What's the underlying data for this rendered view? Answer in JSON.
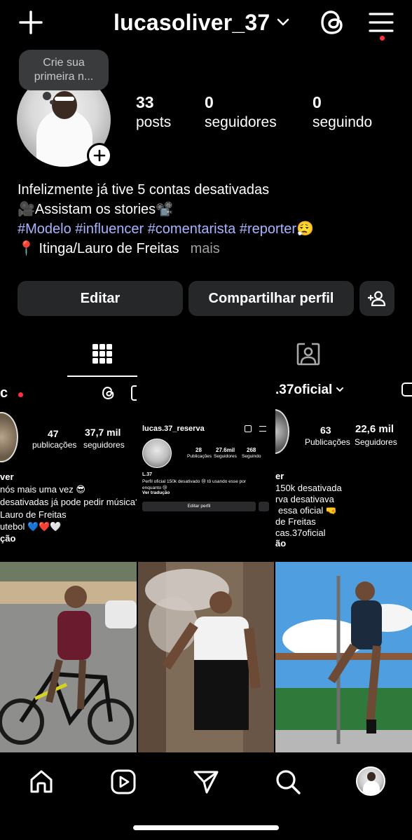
{
  "header": {
    "username": "lucasoliver_37",
    "icons": [
      "plus-icon",
      "chevron-down-icon",
      "threads-icon",
      "hamburger-menu-icon"
    ]
  },
  "profile": {
    "note_placeholder_line1": "Crie sua",
    "note_placeholder_line2": "primeira n...",
    "stats": {
      "posts_count": "33",
      "posts_label": "posts",
      "followers_count": "0",
      "followers_label": "seguidores",
      "following_count": "0",
      "following_label": "seguindo"
    }
  },
  "bio": {
    "line1": "Infelizmente já tive 5 contas desativadas",
    "line2": "🎥Assistam os stories📽️",
    "hashtags": [
      "#Modelo",
      "#influencer",
      "#comentarista",
      "#reporter"
    ],
    "line3_emoji": "😮‍💨",
    "line4": "📍 Itinga/Lauro de Freitas",
    "more": "mais"
  },
  "actions": {
    "edit": "Editar",
    "share": "Compartilhar perfil"
  },
  "grid": {
    "post1": {
      "header": "c",
      "posts_count": "47",
      "posts_label": "publicações",
      "followers_count": "37,7 mil",
      "followers_label": "seguidores",
      "bio_line1": "ver",
      "bio_line2": "nós mais uma vez 😎",
      "bio_line3": "desativadas já pode pedir música?",
      "bio_line4": "Lauro de Freitas",
      "bio_line5": "utebol 💙❤️🤍",
      "bio_line6": "ção"
    },
    "post2": {
      "username": "lucas.37_reserva",
      "posts_count": "28",
      "posts_label": "Publicações",
      "followers_count": "27.6mil",
      "followers_label": "Seguidores",
      "following_count": "268",
      "following_label": "Seguindo",
      "name": "L.37",
      "bio_line1": "Perfil oficial 150k desativado 😢 tô usando esse por",
      "bio_line2": "enquanto 😢",
      "translate": "Ver tradução",
      "edit_button": "Editar perfil"
    },
    "post3": {
      "username": ".37oficial",
      "posts_count": "63",
      "posts_label": "Publicações",
      "followers_count": "22,6 mil",
      "followers_label": "Seguidores",
      "bio_line1": "er",
      "bio_line2": "150k desativada",
      "bio_line3": "rva desativava",
      "bio_line4": "essa oficial 🤜",
      "bio_line5": "de Freitas",
      "bio_line6": "cas.37oficial",
      "bio_line7": "ão"
    }
  },
  "bottom_nav": {
    "items": [
      "home-icon",
      "reels-icon",
      "direct-icon",
      "search-icon",
      "profile-avatar"
    ]
  }
}
